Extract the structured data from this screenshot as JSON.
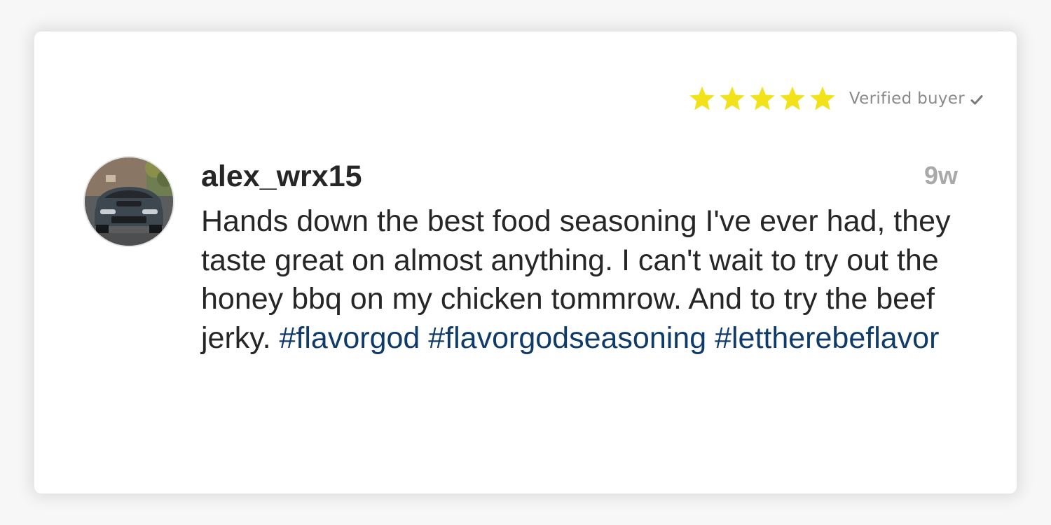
{
  "review": {
    "rating": 5,
    "rating_max": 5,
    "star_color": "#F2E21A",
    "verified_label": "Verified buyer",
    "verified_icon": "check-icon",
    "username": "alex_wrx15",
    "age": "9w",
    "comment_text": "Hands down the best food seasoning I've ever had, they taste great on almost anything. I can't wait to try out the honey bbq on my chicken tommrow. And to try the beef jerky.",
    "hashtags": [
      "#flavorgod",
      "#flavorgodseasoning",
      "#lettherebeflavor"
    ],
    "hashtag_color": "#0F3B6B"
  }
}
